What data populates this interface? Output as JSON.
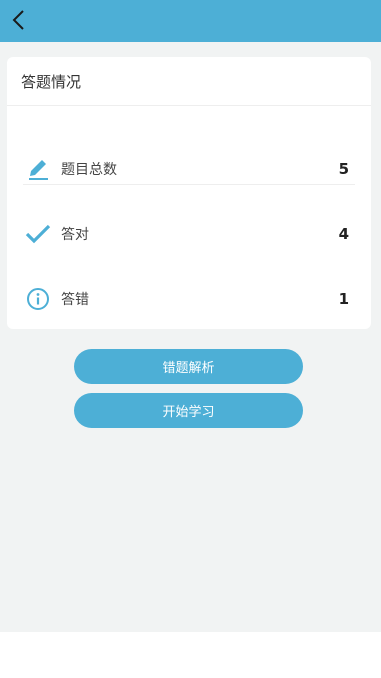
{
  "header": {
    "back_icon": "chevron-left-icon"
  },
  "card": {
    "title": "答题情况",
    "rows": [
      {
        "icon": "pencil-icon",
        "label": "题目总数",
        "value": "5"
      },
      {
        "icon": "check-icon",
        "label": "答对",
        "value": "4"
      },
      {
        "icon": "info-icon",
        "label": "答错",
        "value": "1"
      }
    ]
  },
  "buttons": {
    "review_label": "错题解析",
    "start_label": "开始学习"
  },
  "colors": {
    "accent": "#4dafd6",
    "background": "#f1f3f3"
  }
}
